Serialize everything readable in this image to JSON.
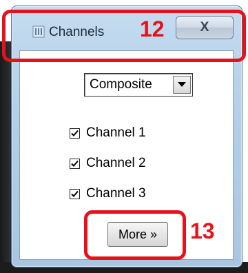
{
  "window": {
    "title": "Channels",
    "close_glyph": "X",
    "icon": "imagej-icon"
  },
  "display_mode": {
    "selected": "Composite"
  },
  "channels": [
    {
      "label": "Channel 1",
      "checked": true
    },
    {
      "label": "Channel 2",
      "checked": true
    },
    {
      "label": "Channel 3",
      "checked": true
    }
  ],
  "more_button": {
    "label": "More »"
  },
  "annotations": [
    {
      "number": "12",
      "color": "#e8111a"
    },
    {
      "number": "13",
      "color": "#e8111a"
    }
  ]
}
